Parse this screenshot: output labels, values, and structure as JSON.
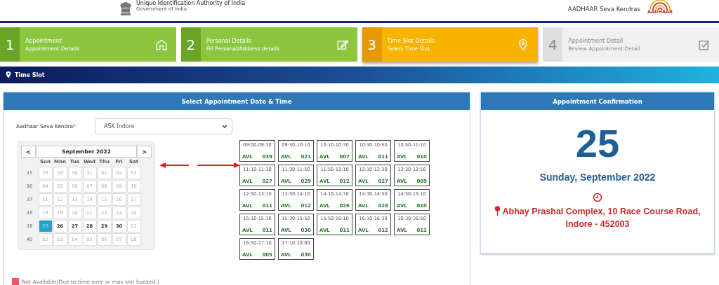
{
  "header": {
    "org_name": "Unique Identification Authority of India",
    "org_sub": "Government of India",
    "brand": "AADHAAR Seva Kendras",
    "logo_text": "AADHAAR"
  },
  "steps": [
    {
      "number": "1",
      "title": "Appointment",
      "subtitle": "Appointment Details",
      "selected": false,
      "disabled": false
    },
    {
      "number": "2",
      "title": "Personal Details",
      "subtitle": "Fill Personal/Address details",
      "selected": false,
      "disabled": false
    },
    {
      "number": "3",
      "title": "Time Slot Details",
      "subtitle": "Select Time Slot",
      "selected": true,
      "disabled": false
    },
    {
      "number": "4",
      "title": "Appointment Detail",
      "subtitle": "Review Appointment Detail",
      "selected": false,
      "disabled": true
    }
  ],
  "section_bar": {
    "title": "Time Slot"
  },
  "selection_panel": {
    "title": "Select Appointment Date & Time",
    "kendra_label": "Aadhaar Seva Kendra",
    "required_mark": "*",
    "kendra_value": "ASK Indore",
    "calendar": {
      "month": "September 2022",
      "prev": "<",
      "next": ">",
      "weekdays": [
        "Sun",
        "Mon",
        "Tue",
        "Wed",
        "Thu",
        "Fri",
        "Sat"
      ],
      "weeks": [
        {
          "number": "35",
          "days": [
            {
              "label": "28",
              "enabled": false,
              "selected": false
            },
            {
              "label": "29",
              "enabled": false,
              "selected": false
            },
            {
              "label": "30",
              "enabled": false,
              "selected": false
            },
            {
              "label": "31",
              "enabled": false,
              "selected": false
            },
            {
              "label": "01",
              "enabled": false,
              "selected": false
            },
            {
              "label": "02",
              "enabled": false,
              "selected": false
            },
            {
              "label": "03",
              "enabled": false,
              "selected": false
            }
          ]
        },
        {
          "number": "36",
          "days": [
            {
              "label": "04",
              "enabled": false,
              "selected": false
            },
            {
              "label": "05",
              "enabled": false,
              "selected": false
            },
            {
              "label": "06",
              "enabled": false,
              "selected": false
            },
            {
              "label": "07",
              "enabled": false,
              "selected": false
            },
            {
              "label": "08",
              "enabled": false,
              "selected": false
            },
            {
              "label": "09",
              "enabled": false,
              "selected": false
            },
            {
              "label": "10",
              "enabled": false,
              "selected": false
            }
          ]
        },
        {
          "number": "37",
          "days": [
            {
              "label": "11",
              "enabled": false,
              "selected": false
            },
            {
              "label": "12",
              "enabled": false,
              "selected": false
            },
            {
              "label": "13",
              "enabled": false,
              "selected": false
            },
            {
              "label": "14",
              "enabled": false,
              "selected": false
            },
            {
              "label": "15",
              "enabled": false,
              "selected": false
            },
            {
              "label": "16",
              "enabled": false,
              "selected": false
            },
            {
              "label": "17",
              "enabled": false,
              "selected": false
            }
          ]
        },
        {
          "number": "38",
          "days": [
            {
              "label": "18",
              "enabled": false,
              "selected": false
            },
            {
              "label": "19",
              "enabled": false,
              "selected": false
            },
            {
              "label": "20",
              "enabled": false,
              "selected": false
            },
            {
              "label": "21",
              "enabled": false,
              "selected": false
            },
            {
              "label": "22",
              "enabled": false,
              "selected": false
            },
            {
              "label": "23",
              "enabled": false,
              "selected": false
            },
            {
              "label": "24",
              "enabled": false,
              "selected": false
            }
          ]
        },
        {
          "number": "39",
          "days": [
            {
              "label": "25",
              "enabled": true,
              "selected": true
            },
            {
              "label": "26",
              "enabled": true,
              "selected": false
            },
            {
              "label": "27",
              "enabled": true,
              "selected": false
            },
            {
              "label": "28",
              "enabled": true,
              "selected": false
            },
            {
              "label": "29",
              "enabled": true,
              "selected": false
            },
            {
              "label": "30",
              "enabled": true,
              "selected": false
            },
            {
              "label": "01",
              "enabled": false,
              "selected": false
            }
          ]
        },
        {
          "number": "40",
          "days": [
            {
              "label": "02",
              "enabled": false,
              "selected": false
            },
            {
              "label": "03",
              "enabled": false,
              "selected": false
            },
            {
              "label": "04",
              "enabled": false,
              "selected": false
            },
            {
              "label": "05",
              "enabled": false,
              "selected": false
            },
            {
              "label": "06",
              "enabled": false,
              "selected": false
            },
            {
              "label": "07",
              "enabled": false,
              "selected": false
            },
            {
              "label": "08",
              "enabled": false,
              "selected": false
            }
          ]
        }
      ]
    },
    "slots": [
      {
        "time": "09:00-09:30",
        "status": "AVL",
        "count": "039"
      },
      {
        "time": "09:30-10:10",
        "status": "AVL",
        "count": "021"
      },
      {
        "time": "10:10-10:30",
        "status": "AVL",
        "count": "007"
      },
      {
        "time": "10:30-10:50",
        "status": "AVL",
        "count": "011"
      },
      {
        "time": "10:50-11:10",
        "status": "AVL",
        "count": "010"
      },
      {
        "time": "11:10-11:30",
        "status": "AVL",
        "count": "027"
      },
      {
        "time": "11:30-11:50",
        "status": "AVL",
        "count": "029"
      },
      {
        "time": "11:50-12:10",
        "status": "AVL",
        "count": "012"
      },
      {
        "time": "12:10-12:30",
        "status": "AVL",
        "count": "027"
      },
      {
        "time": "12:30-12:50",
        "status": "AVL",
        "count": "009"
      },
      {
        "time": "12:50-13:10",
        "status": "AVL",
        "count": "011"
      },
      {
        "time": "13:50-14:10",
        "status": "AVL",
        "count": "012"
      },
      {
        "time": "14:10-14:30",
        "status": "AVL",
        "count": "026"
      },
      {
        "time": "14:30-14:50",
        "status": "AVL",
        "count": "028"
      },
      {
        "time": "14:50-15:10",
        "status": "AVL",
        "count": "010"
      },
      {
        "time": "15:10-15:30",
        "status": "AVL",
        "count": "011"
      },
      {
        "time": "15:30-15:50",
        "status": "AVL",
        "count": "030"
      },
      {
        "time": "15:50-16:10",
        "status": "AVL",
        "count": "011"
      },
      {
        "time": "16:10-16:30",
        "status": "AVL",
        "count": "012"
      },
      {
        "time": "16:30-16:50",
        "status": "AVL",
        "count": "012"
      },
      {
        "time": "16:50-17:10",
        "status": "AVL",
        "count": "005"
      },
      {
        "time": "17:10-18:00",
        "status": "AVL",
        "count": "030"
      }
    ],
    "legend": [
      {
        "label": "Not Available(Due to time over or max slot booked.)",
        "color": "#e8576e"
      }
    ]
  },
  "confirmation_panel": {
    "title": "Appointment Confirmation",
    "day": "25",
    "date": "Sunday, September 2022",
    "address": "Abhay Prashal Complex, 10 Race Course Road, Indore - 452003"
  }
}
